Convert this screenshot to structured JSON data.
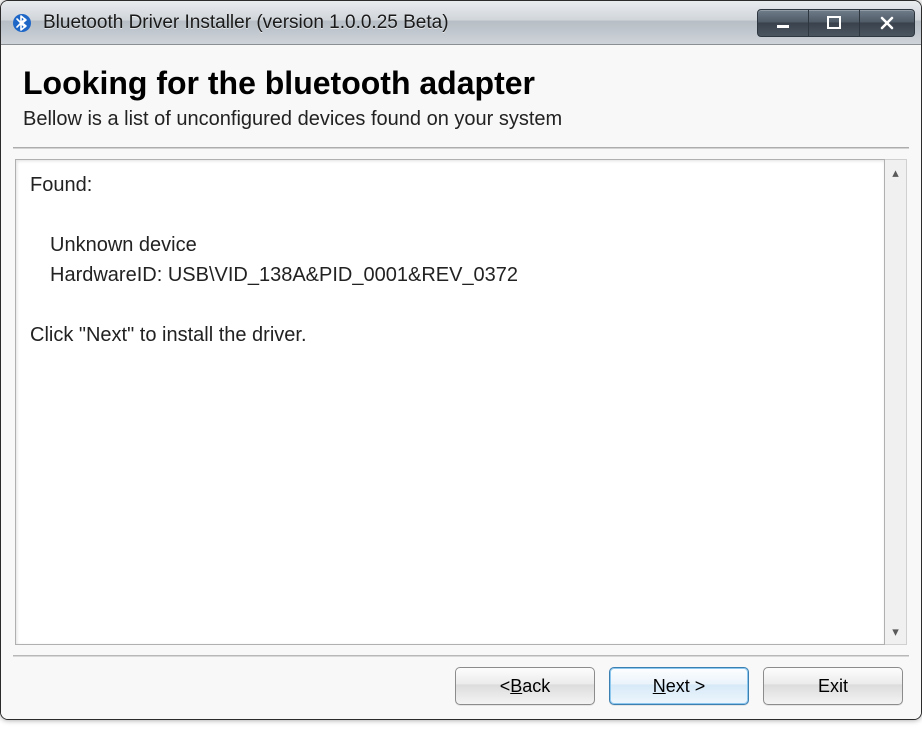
{
  "window": {
    "title": "Bluetooth Driver Installer (version 1.0.0.25 Beta)"
  },
  "header": {
    "heading": "Looking for the bluetooth adapter",
    "subtext": "Bellow is a list of unconfigured devices found on your system"
  },
  "results": {
    "found_label": "Found:",
    "device_name": "Unknown device",
    "hardware_id_label": "HardwareID:",
    "hardware_id_value": "USB\\VID_138A&PID_0001&REV_0372",
    "instruction": "Click \"Next\" to install the driver."
  },
  "buttons": {
    "back_prefix": "< ",
    "back_m": "B",
    "back_rest": "ack",
    "next_m": "N",
    "next_rest": "ext >",
    "exit": "Exit"
  }
}
